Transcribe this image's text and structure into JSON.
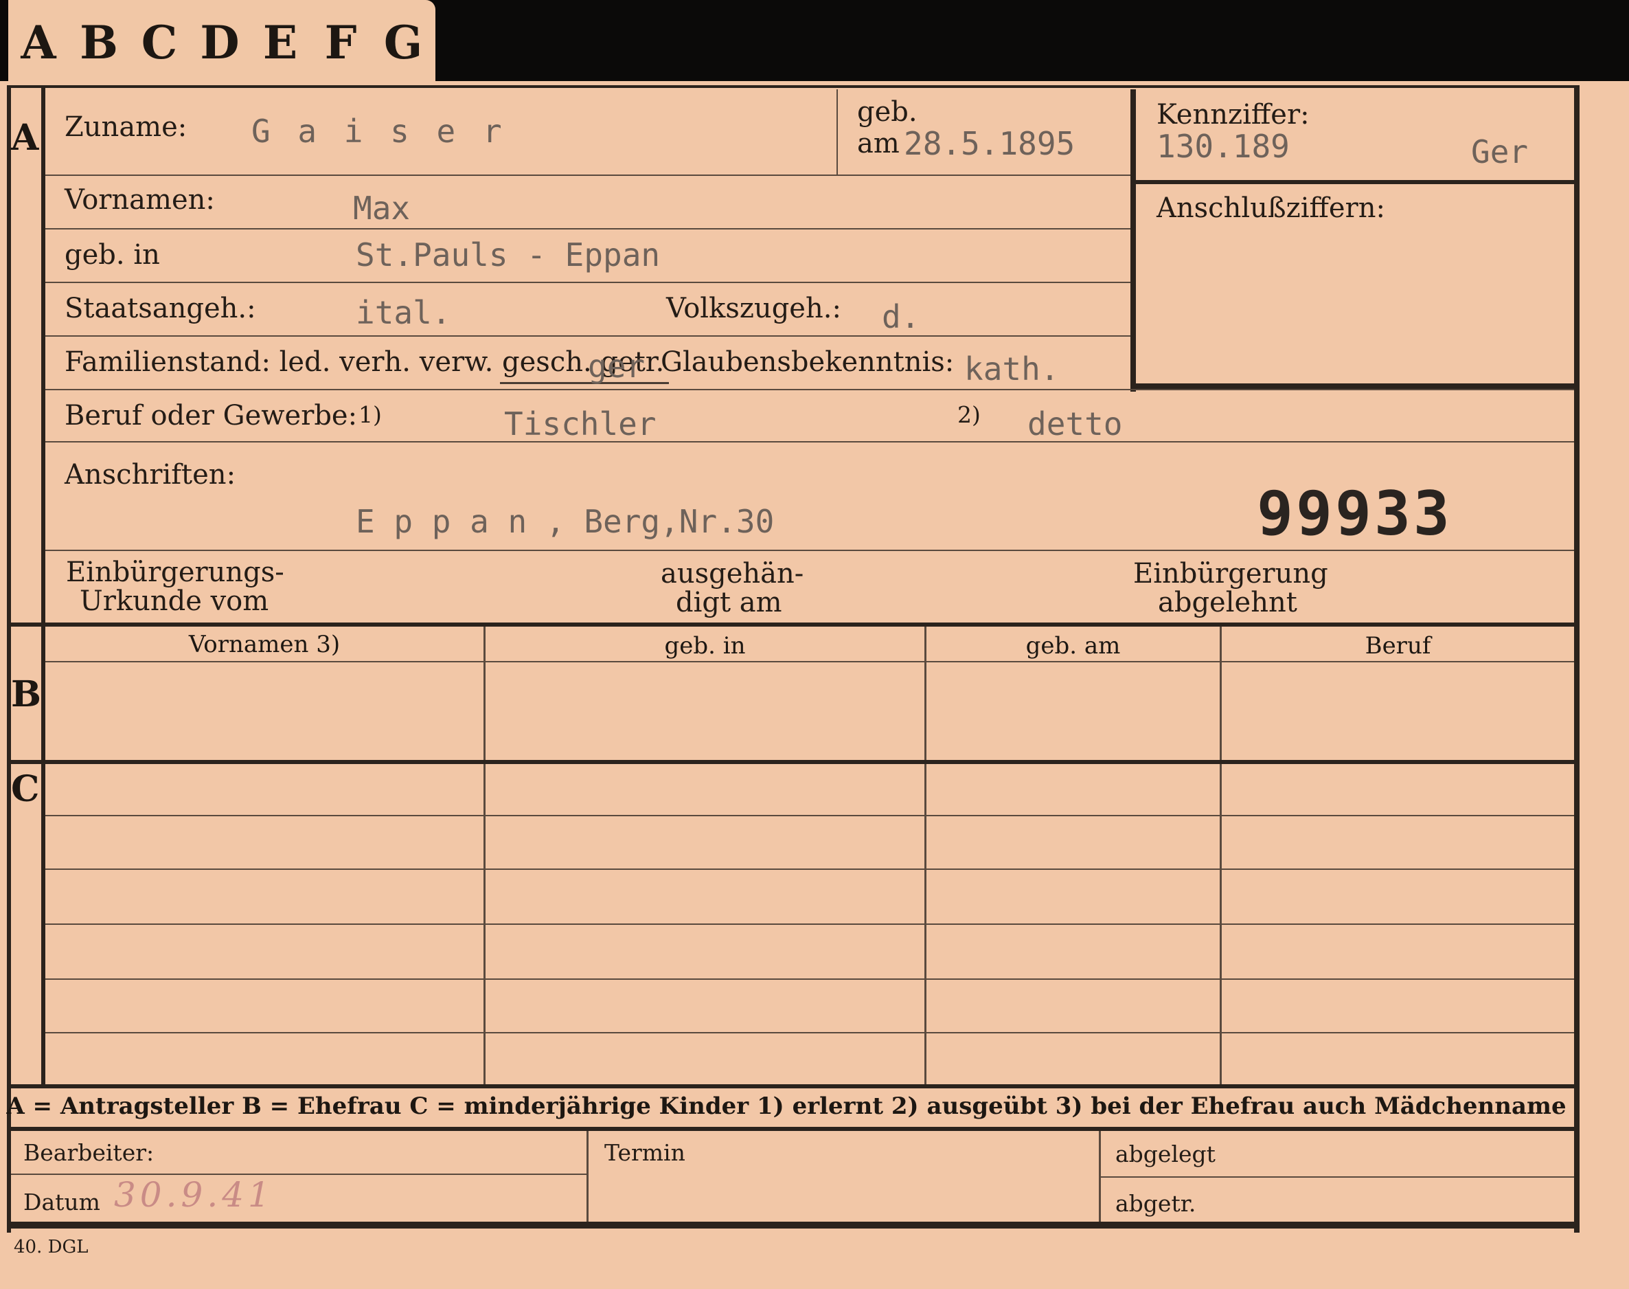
{
  "tabs": [
    "A",
    "B",
    "C",
    "D",
    "E",
    "F",
    "G"
  ],
  "sections": {
    "a": "A",
    "b": "B",
    "c": "C"
  },
  "fields": {
    "zuname_label": "Zuname:",
    "zuname_value": "G a i s e r",
    "geb_label": "geb.",
    "am_label": "am",
    "geb_am_value": "28.5.1895",
    "kennziffer_label": "Kennziffer:",
    "kennziffer_value": "130.189",
    "kennziffer_code": "Ger",
    "anschluss_label": "Anschlußziffern:",
    "vornamen_label": "Vornamen:",
    "vornamen_value": "Max",
    "gebin_label": "geb. in",
    "gebin_value": "St.Pauls - Eppan",
    "staats_label": "Staatsangeh.:",
    "staats_value": "ital.",
    "volks_label": "Volkszugeh.:",
    "volks_value": "d.",
    "familien_label": "Familienstand: led. verh. verw. gesch. getr.",
    "familien_value": "ger",
    "glauben_label": "Glaubensbekenntnis:",
    "glauben_value": "kath.",
    "beruf_label": "Beruf oder Gewerbe:",
    "beruf_mark1": "1)",
    "beruf_value1": "Tischler",
    "beruf_mark2": "2)",
    "beruf_value2": "detto",
    "anschriften_label": "Anschriften:",
    "anschriften_value": "E p p a n , Berg,Nr.30",
    "stamp_number": "99933",
    "einb_urkunde_l1": "Einbürgerungs-",
    "einb_urkunde_l2": "Urkunde vom",
    "ausgeh_l1": "ausgehän-",
    "ausgeh_l2": "digt am",
    "einb_abg_l1": "Einbürgerung",
    "einb_abg_l2": "abgelehnt"
  },
  "table_headers": [
    "Vornamen 3)",
    "geb. in",
    "geb. am",
    "Beruf"
  ],
  "legend": "A = Antragsteller   B = Ehefrau   C = minderjährige Kinder   1) erlernt   2) ausgeübt   3) bei der Ehefrau auch Mädchenname",
  "footer": {
    "bearbeiter_label": "Bearbeiter:",
    "datum_label": "Datum",
    "datum_value": "30.9.41",
    "termin_label": "Termin",
    "abgelegt_label": "abgelegt",
    "abgetr_label": "abgetr."
  },
  "print_mark": "40. DGL"
}
